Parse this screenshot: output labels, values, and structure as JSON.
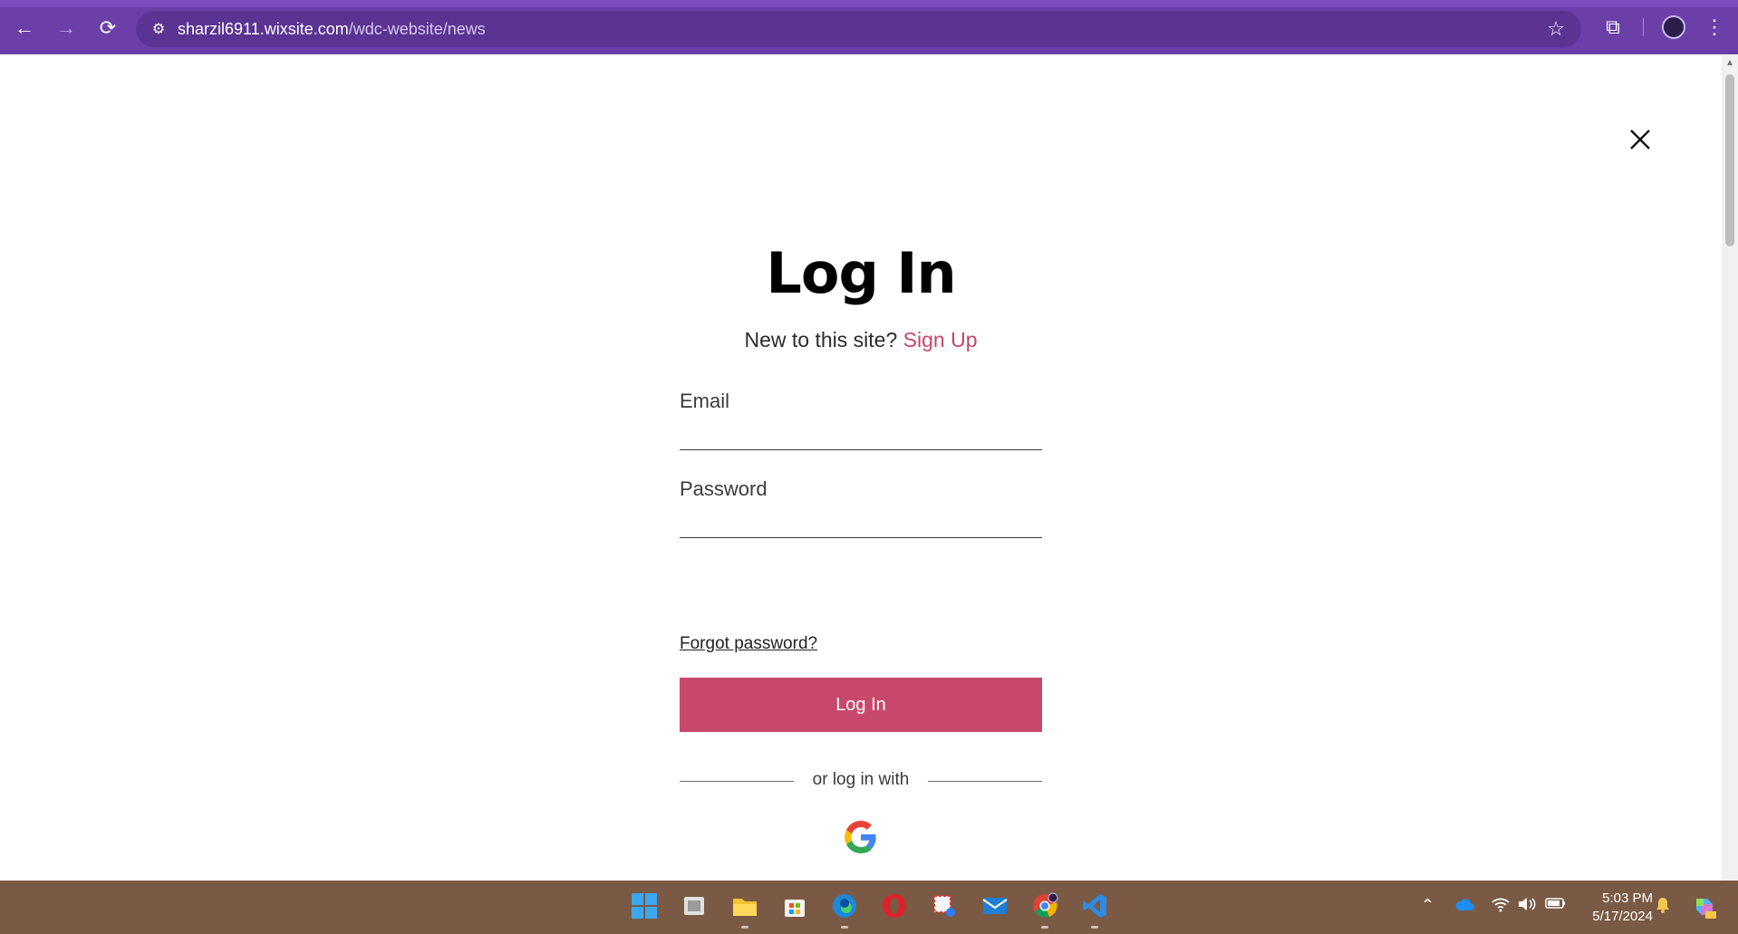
{
  "browser": {
    "url_domain": "sharzil6911.wixsite.com",
    "url_path": "/wdc-website/news",
    "back_icon": "←",
    "forward_icon": "→",
    "reload_icon": "⟳",
    "site_info_icon": "⚙",
    "bookmark_icon": "☆",
    "extensions_icon": "⧉",
    "menu_icon": "⋮"
  },
  "login": {
    "title": "Log In",
    "new_to_site": "New to this site?",
    "sign_up": "Sign Up",
    "email_label": "Email",
    "email_value": "",
    "password_label": "Password",
    "password_value": "",
    "forgot_password": "Forgot password?",
    "login_button": "Log In",
    "or_log_in_with": "or log in with"
  },
  "colors": {
    "accent": "#c8486b",
    "browser_frame": "#6b3fa8",
    "taskbar": "#7a5a44"
  },
  "taskbar": {
    "time": "5:03 PM",
    "date": "5/17/2024",
    "icons": [
      "start-icon",
      "task-view-icon",
      "file-explorer-icon",
      "store-icon",
      "edge-icon",
      "opera-icon",
      "snipping-tool-icon",
      "mail-icon",
      "chrome-icon",
      "vscode-icon"
    ]
  }
}
